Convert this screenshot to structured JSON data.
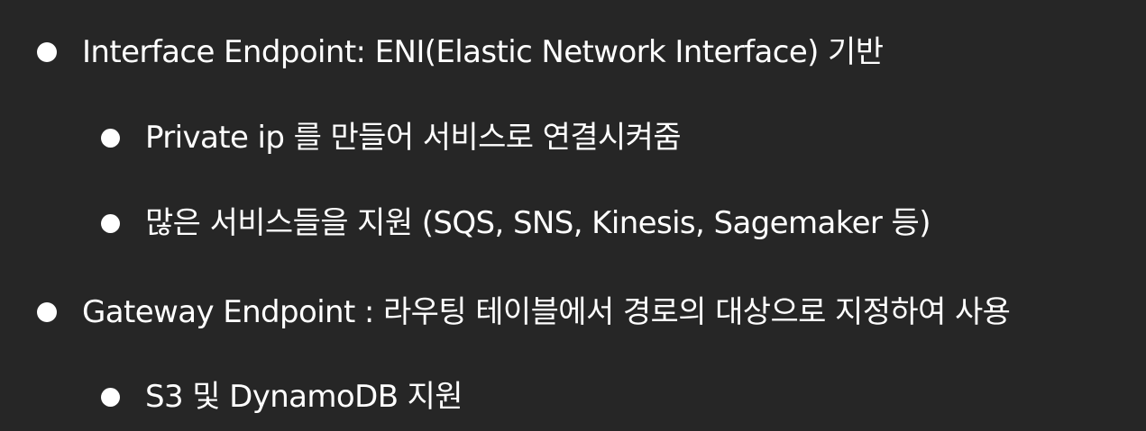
{
  "bullets": [
    {
      "level": 1,
      "text": "Interface Endpoint: ENI(Elastic Network Interface) 기반"
    },
    {
      "level": 2,
      "text": "Private ip 를 만들어 서비스로 연결시켜줌"
    },
    {
      "level": 2,
      "text": "많은 서비스들을 지원 (SQS, SNS, Kinesis, Sagemaker 등)"
    },
    {
      "level": 1,
      "text": "Gateway Endpoint : 라우팅 테이블에서 경로의 대상으로 지정하여 사용"
    },
    {
      "level": 2,
      "text": "S3 및 DynamoDB 지원"
    }
  ],
  "colors": {
    "background": "#262626",
    "text": "#ffffff",
    "bullet": "#ffffff"
  }
}
